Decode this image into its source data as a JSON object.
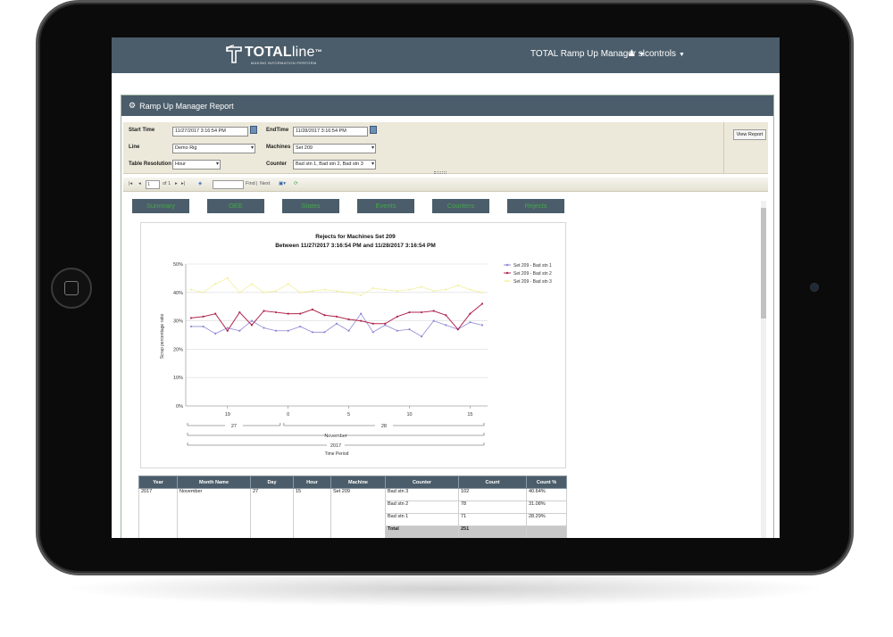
{
  "header": {
    "logo_bold": "TOTAL",
    "logo_thin": "line",
    "logo_tm": "™",
    "logo_tagline": "MAKING INFORMATION PERFORM",
    "nav_manager": "TOTAL Ramp Up Manager",
    "nav_user": "slcontrols",
    "user_icon": "user-icon"
  },
  "panel": {
    "title": "Ramp Up Manager Report",
    "icon": "gear-icon"
  },
  "params": {
    "start_time_label": "Start Time",
    "start_time_value": "11/27/2017 3:16:54 PM",
    "end_time_label": "EndTime",
    "end_time_value": "11/28/2017 3:16:54 PM",
    "line_label": "Line",
    "line_value": "Demo Rig",
    "machines_label": "Machines",
    "machines_value": "Set 209",
    "resolution_label": "Table Resolution",
    "resolution_value": "Hour",
    "counter_label": "Counter",
    "counter_value": "Bad stn 1, Bad stn 2, Bad stn 3",
    "view_report": "View Report"
  },
  "toolbar": {
    "page_value": "1",
    "of_pages": "of 1",
    "find": "Find",
    "separator": "|",
    "next": "Next"
  },
  "tabs": [
    "Summary",
    "OEE",
    "States",
    "Events",
    "Counters",
    "Rejects"
  ],
  "chart_data": {
    "type": "line",
    "title": "Rejects for Machines Set 209",
    "subtitle": "Between 11/27/2017 3:16:54 PM and 11/28/2017 3:16:54 PM",
    "xlabel": "Time Period",
    "ylabel": "Scrap percentage ratio",
    "ylim": [
      0,
      50
    ],
    "yticks": [
      "0%",
      "10%",
      "20%",
      "30%",
      "40%",
      "50%"
    ],
    "x": [
      16,
      17,
      18,
      19,
      20,
      21,
      22,
      23,
      0,
      1,
      2,
      3,
      4,
      5,
      6,
      7,
      8,
      9,
      10,
      11,
      12,
      13,
      14,
      15,
      16
    ],
    "xticks": [
      "19",
      "0",
      "5",
      "10",
      "15"
    ],
    "group_day": [
      "27",
      "28"
    ],
    "group_month": [
      "November"
    ],
    "group_year": [
      "2017"
    ],
    "legend_position": "right",
    "series": [
      {
        "name": "Set 209 - Bad stn 1",
        "color": "#8f88d6",
        "values": [
          28,
          28,
          25.5,
          27.5,
          26.5,
          30,
          27.5,
          26.5,
          26.5,
          28,
          26,
          26,
          29,
          26.5,
          32.5,
          26,
          28.5,
          26.5,
          27,
          24.5,
          30,
          28.5,
          27,
          29.5,
          28.5
        ]
      },
      {
        "name": "Set 209 - Bad stn 2",
        "color": "#b0244d",
        "values": [
          31,
          31.5,
          32.5,
          26.5,
          33,
          28.5,
          33.5,
          33,
          32.5,
          32.5,
          34,
          32,
          31.5,
          30.5,
          30,
          29,
          29,
          31.5,
          33,
          33,
          33.5,
          32,
          27,
          32.5,
          36
        ]
      },
      {
        "name": "Set 209 - Bad stn 3",
        "color": "#f3f0a0",
        "values": [
          41,
          40,
          43,
          45,
          40,
          43,
          40,
          40.5,
          43,
          40,
          40.5,
          41,
          40.5,
          40,
          39,
          41.5,
          41,
          40.5,
          41,
          42,
          40.5,
          41,
          42.5,
          41,
          40
        ]
      }
    ]
  },
  "table": {
    "headers": [
      "Year",
      "Month Name",
      "Day",
      "Hour",
      "Machine",
      "Counter",
      "Count",
      "Count %"
    ],
    "year": "2017",
    "month": "November",
    "day": "27",
    "hour": "15",
    "machine": "Set 209",
    "rows": [
      {
        "counter": "Bad stn 3",
        "count": "102",
        "pct": "40.64%"
      },
      {
        "counter": "Bad stn 2",
        "count": "78",
        "pct": "31.08%"
      },
      {
        "counter": "Bad stn 1",
        "count": "71",
        "pct": "28.29%"
      }
    ],
    "total_label": "Total",
    "total_count": "251"
  }
}
